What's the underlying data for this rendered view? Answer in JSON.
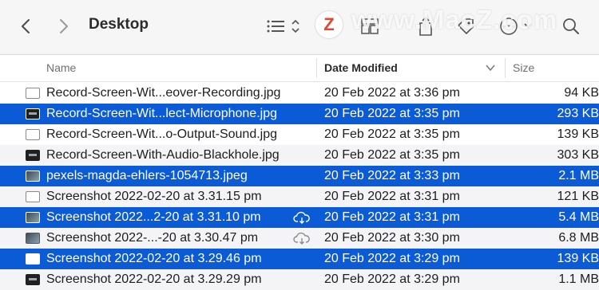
{
  "window": {
    "title": "Desktop"
  },
  "toolbar": {
    "icons": [
      "chevron-left-icon",
      "chevron-right-icon",
      "list-view-icon",
      "group-icon",
      "share-icon",
      "tag-icon",
      "more-icon",
      "search-icon"
    ],
    "watermark": "www.MacZ.com",
    "watermark_logo": "Z"
  },
  "columns": {
    "name": "Name",
    "date_modified": "Date Modified",
    "size": "Size",
    "sorted_by": "Date Modified"
  },
  "files": [
    {
      "name": "Record-Screen-Wit...eover-Recording.jpg",
      "date": "20 Feb 2022 at 3:36 pm",
      "size": "94 KB",
      "selected": false,
      "icon": "document-icon",
      "cloud": false
    },
    {
      "name": "Record-Screen-Wit...lect-Microphone.jpg",
      "date": "20 Feb 2022 at 3:35 pm",
      "size": "293 KB",
      "selected": true,
      "icon": "image-dark-icon",
      "cloud": false
    },
    {
      "name": "Record-Screen-Wit...o-Output-Sound.jpg",
      "date": "20 Feb 2022 at 3:35 pm",
      "size": "139 KB",
      "selected": false,
      "icon": "document-icon",
      "cloud": false
    },
    {
      "name": "Record-Screen-With-Audio-Blackhole.jpg",
      "date": "20 Feb 2022 at 3:35 pm",
      "size": "303 KB",
      "selected": false,
      "icon": "image-dark-icon",
      "cloud": false
    },
    {
      "name": "pexels-magda-ehlers-1054713.jpeg",
      "date": "20 Feb 2022 at 3:33 pm",
      "size": "2.1 MB",
      "selected": true,
      "icon": "photo-icon",
      "cloud": false
    },
    {
      "name": "Screenshot 2022-02-20 at 3.31.15 pm",
      "date": "20 Feb 2022 at 3:31 pm",
      "size": "121 KB",
      "selected": false,
      "icon": "document-icon",
      "cloud": false
    },
    {
      "name": "Screenshot 2022...2-20 at 3.31.10 pm",
      "date": "20 Feb 2022 at 3:31 pm",
      "size": "5.4 MB",
      "selected": true,
      "icon": "photo-icon",
      "cloud": true
    },
    {
      "name": "Screenshot 2022-...-20 at 3.30.47 pm",
      "date": "20 Feb 2022 at 3:30 pm",
      "size": "6.8 MB",
      "selected": false,
      "icon": "photo-icon",
      "cloud": true
    },
    {
      "name": "Screenshot 2022-02-20 at 3.29.46 pm",
      "date": "20 Feb 2022 at 3:29 pm",
      "size": "139 KB",
      "selected": true,
      "icon": "document-icon",
      "cloud": false
    },
    {
      "name": "Screenshot 2022-02-20 at 3.29.29 pm",
      "date": "20 Feb 2022 at 3:29 pm",
      "size": "1.1 MB",
      "selected": false,
      "icon": "image-dark-icon",
      "cloud": false
    }
  ],
  "colors": {
    "selection": "#0b5bd7",
    "alt_row": "#f4f4f6",
    "toolbar_bg": "#f6f6f6"
  }
}
